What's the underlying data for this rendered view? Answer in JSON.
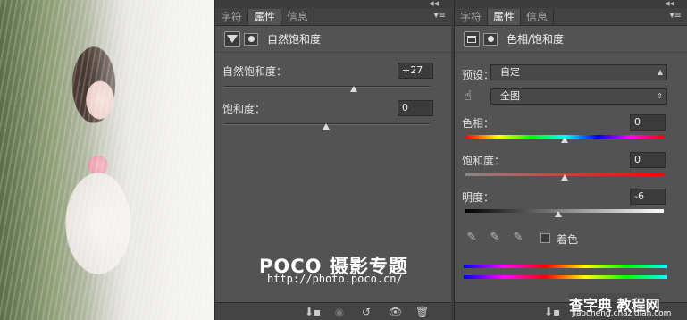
{
  "left_panel": {
    "tabs": [
      "字符",
      "属性",
      "信息"
    ],
    "active_tab": "属性",
    "header_title": "自然饱和度",
    "vibrance": {
      "label": "自然饱和度：",
      "value": "+27",
      "thumb_pct": 0.58
    },
    "saturation": {
      "label": "饱和度：",
      "value": "0",
      "thumb_pct": 0.5
    }
  },
  "right_panel": {
    "tabs": [
      "字符",
      "属性",
      "信息"
    ],
    "active_tab": "属性",
    "header_title": "色相/饱和度",
    "preset_label": "预设：",
    "preset_value": "自定",
    "channel_value": "全图",
    "hue": {
      "label": "色相：",
      "value": "0",
      "thumb_pct": 0.5
    },
    "saturation": {
      "label": "饱和度：",
      "value": "0",
      "thumb_pct": 0.5
    },
    "lightness": {
      "label": "明度：",
      "value": "-6",
      "thumb_pct": 0.47
    },
    "colorize_label": "着色"
  },
  "watermarks": {
    "poco_title": "POCO 摄影专题",
    "poco_url": "http://photo.poco.cn/",
    "site_title": "查字典 教程网",
    "site_url": "jiaocheng.chazidian.com"
  },
  "colors": {
    "panel_bg": "#535353",
    "field_bg": "#3b3b3b",
    "tab_bg": "#424242"
  }
}
